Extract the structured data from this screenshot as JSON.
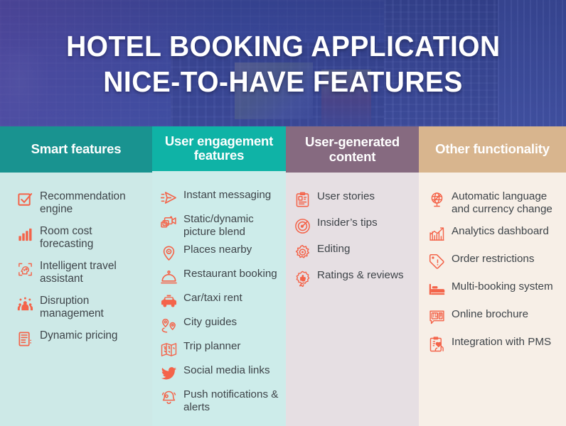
{
  "hero": {
    "title_line1": "HOTEL BOOKING APPLICATION",
    "title_line2": "NICE-TO-HAVE FEATURES",
    "overlay_color": "#5648a2",
    "text_color": "#ffffff"
  },
  "theme": {
    "icon_color": "#f4644a",
    "body_text_color": "#3e4449"
  },
  "columns": [
    {
      "header": "Smart features",
      "header_bg": "#199390",
      "body_bg": "#cde9e7",
      "items": [
        {
          "label": "Recommendation engine",
          "icon": "checkbox-check-icon"
        },
        {
          "label": "Room cost forecasting",
          "icon": "bar-chart-icon"
        },
        {
          "label": "Intelligent travel assistant",
          "icon": "ai-head-icon"
        },
        {
          "label": "Disruption management",
          "icon": "people-group-icon"
        },
        {
          "label": "Dynamic pricing",
          "icon": "price-list-icon"
        }
      ]
    },
    {
      "header": "User engagement features",
      "header_bg": "#0fb3a6",
      "body_bg": "#cdecea",
      "items": [
        {
          "label": "Instant messaging",
          "icon": "send-plane-icon"
        },
        {
          "label": "Static/dynamic picture blend",
          "icon": "camera-photos-icon"
        },
        {
          "label": "Places nearby",
          "icon": "map-pin-icon"
        },
        {
          "label": "Restaurant booking",
          "icon": "service-bell-icon"
        },
        {
          "label": "Car/taxi rent",
          "icon": "taxi-icon"
        },
        {
          "label": "City guides",
          "icon": "two-pins-icon"
        },
        {
          "label": "Trip planner",
          "icon": "folded-map-icon"
        },
        {
          "label": "Social media links",
          "icon": "twitter-bird-icon"
        },
        {
          "label": "Push notifications & alerts",
          "icon": "bell-alert-icon"
        }
      ]
    },
    {
      "header": "User-generated content",
      "header_bg": "#866a80",
      "body_bg": "#e6dfe3",
      "items": [
        {
          "label": "User stories",
          "icon": "id-clipboard-icon"
        },
        {
          "label": "Insider’s tips",
          "icon": "target-circle-icon"
        },
        {
          "label": "Editing",
          "icon": "gear-icon"
        },
        {
          "label": "Ratings & reviews",
          "icon": "thumbs-up-badge-icon"
        }
      ]
    },
    {
      "header": "Other functionality",
      "header_bg": "#d8b58e",
      "body_bg": "#f7efe7",
      "items": [
        {
          "label": "Automatic language and currency change",
          "icon": "globe-stand-icon"
        },
        {
          "label": "Analytics dashboard",
          "icon": "analytics-growth-icon"
        },
        {
          "label": "Order restrictions",
          "icon": "warning-tag-icon"
        },
        {
          "label": "Multi-booking system",
          "icon": "bed-icon"
        },
        {
          "label": "Online brochure",
          "icon": "brochure-chat-icon"
        },
        {
          "label": "Integration with PMS",
          "icon": "clipboard-hands-icon"
        }
      ]
    }
  ]
}
